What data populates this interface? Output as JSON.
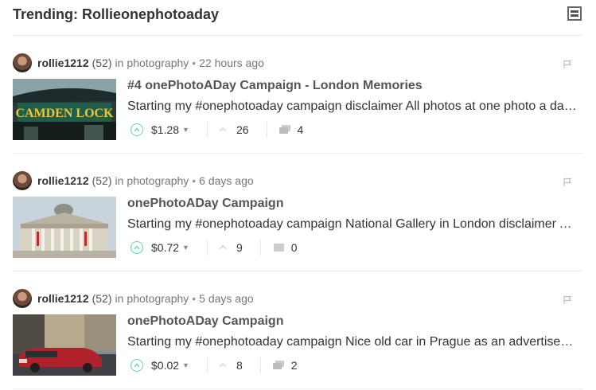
{
  "header": {
    "title": "Trending: Rollieonephotoaday"
  },
  "posts": [
    {
      "author": "rollie1212",
      "rep": "(52)",
      "in_label": "in",
      "category": "photography",
      "time": "22 hours ago",
      "thumb": "camden-lock-sign",
      "title": "#4 onePhotoADay Campaign - London Memories",
      "body": "Starting my #onephotoaday campaign disclaimer All photos at one photo a day campaign are taken by me",
      "payout": "$1.28",
      "votes": "26",
      "comments": "4"
    },
    {
      "author": "rollie1212",
      "rep": "(52)",
      "in_label": "in",
      "category": "photography",
      "time": "6 days ago",
      "thumb": "national-gallery",
      "title": "onePhotoADay Campaign",
      "body": "Starting my #onephotoaday campaign National Gallery in London disclaimer All photos are taken by me",
      "payout": "$0.72",
      "votes": "9",
      "comments": "0"
    },
    {
      "author": "rollie1212",
      "rep": "(52)",
      "in_label": "in",
      "category": "photography",
      "time": "5 days ago",
      "thumb": "red-car-prague",
      "title": "onePhotoADay Campaign",
      "body": "Starting my #onephotoaday campaign Nice old car in Prague as an advertisement for tours",
      "payout": "$0.02",
      "votes": "8",
      "comments": "2"
    }
  ],
  "colors": {
    "upvote": "#5dd6b4",
    "text": "#333333",
    "muted": "#777777"
  }
}
